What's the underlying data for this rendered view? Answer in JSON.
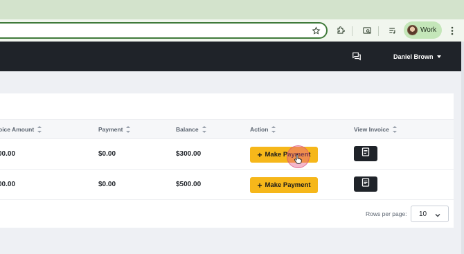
{
  "browser": {
    "profile_name": "Work"
  },
  "header": {
    "user_name": "Daniel Brown"
  },
  "table": {
    "columns": [
      {
        "label": "oice Amount"
      },
      {
        "label": "Payment"
      },
      {
        "label": "Balance"
      },
      {
        "label": "Action"
      },
      {
        "label": "View Invoice"
      }
    ],
    "rows": [
      {
        "invoice_amount": "00.00",
        "payment": "$0.00",
        "balance": "$300.00",
        "action_label": "Make Payment"
      },
      {
        "invoice_amount": "00.00",
        "payment": "$0.00",
        "balance": "$500.00",
        "action_label": "Make Payment"
      }
    ]
  },
  "pagination": {
    "rows_per_page_label": "Rows per page:",
    "rows_per_page_value": "10"
  },
  "colors": {
    "header_bg": "#1f2329",
    "accent_button": "#f6b71a",
    "browser_frame": "#d3e3cc",
    "profile_chip": "#c4e6b9"
  },
  "icons": [
    "star-icon",
    "extensions-icon",
    "search-tab-icon",
    "media-queue-icon",
    "more-vert-icon",
    "chat-icon",
    "chevron-down-icon",
    "sort-icon",
    "plus-icon",
    "invoice-icon",
    "hand-cursor-icon"
  ]
}
